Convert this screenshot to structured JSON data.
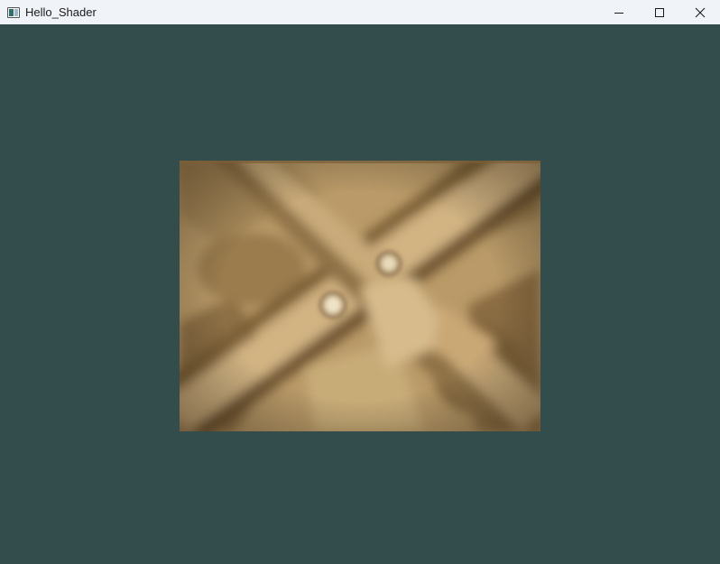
{
  "window": {
    "title": "Hello_Shader",
    "clear_color": "#334d4d",
    "titlebar_color": "#f0f4f9"
  },
  "titlebar": {
    "controls": [
      {
        "name": "minimize-icon"
      },
      {
        "name": "maximize-icon"
      },
      {
        "name": "close-icon"
      }
    ]
  },
  "scene": {
    "textured_quad": {
      "texture": "wooden-crate-texture",
      "base_color": "#b99a68"
    }
  }
}
